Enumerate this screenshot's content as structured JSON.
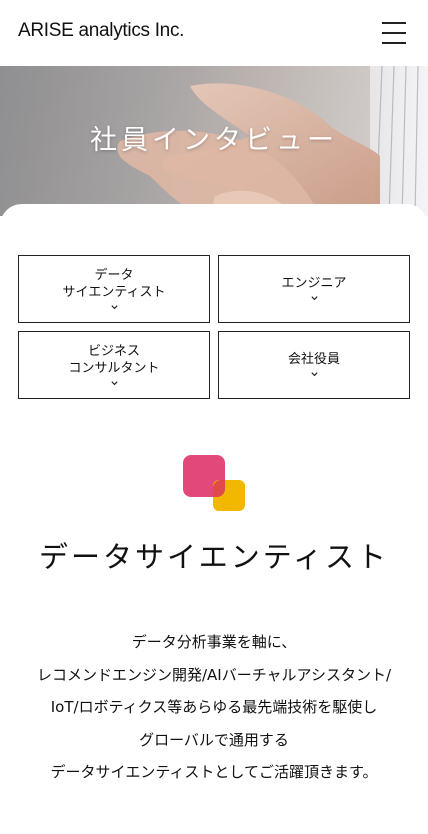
{
  "header": {
    "logo": "ARISE analytics Inc.",
    "menu_icon": "hamburger-menu-icon"
  },
  "hero": {
    "title": "社員インタビュー"
  },
  "tabs": [
    {
      "label": "データ\nサイエンティスト",
      "icon": "chevron-down-icon"
    },
    {
      "label": "エンジニア",
      "icon": "chevron-down-icon"
    },
    {
      "label": "ビジネス\nコンサルタント",
      "icon": "chevron-down-icon"
    },
    {
      "label": "会社役員",
      "icon": "chevron-down-icon"
    }
  ],
  "section": {
    "icon": "overlapping-squares-icon",
    "colors": {
      "pink": "#e2487a",
      "yellow": "#f2b800"
    },
    "title": "データサイエンティスト",
    "description": [
      "データ分析事業を軸に、",
      "レコメンドエンジン開発/AIバーチャルアシスタント/",
      "IoT/ロボティクス等あらゆる最先端技術を駆使し",
      "グローバルで通用する",
      "データサイエンティストとしてご活躍頂きます。"
    ]
  }
}
